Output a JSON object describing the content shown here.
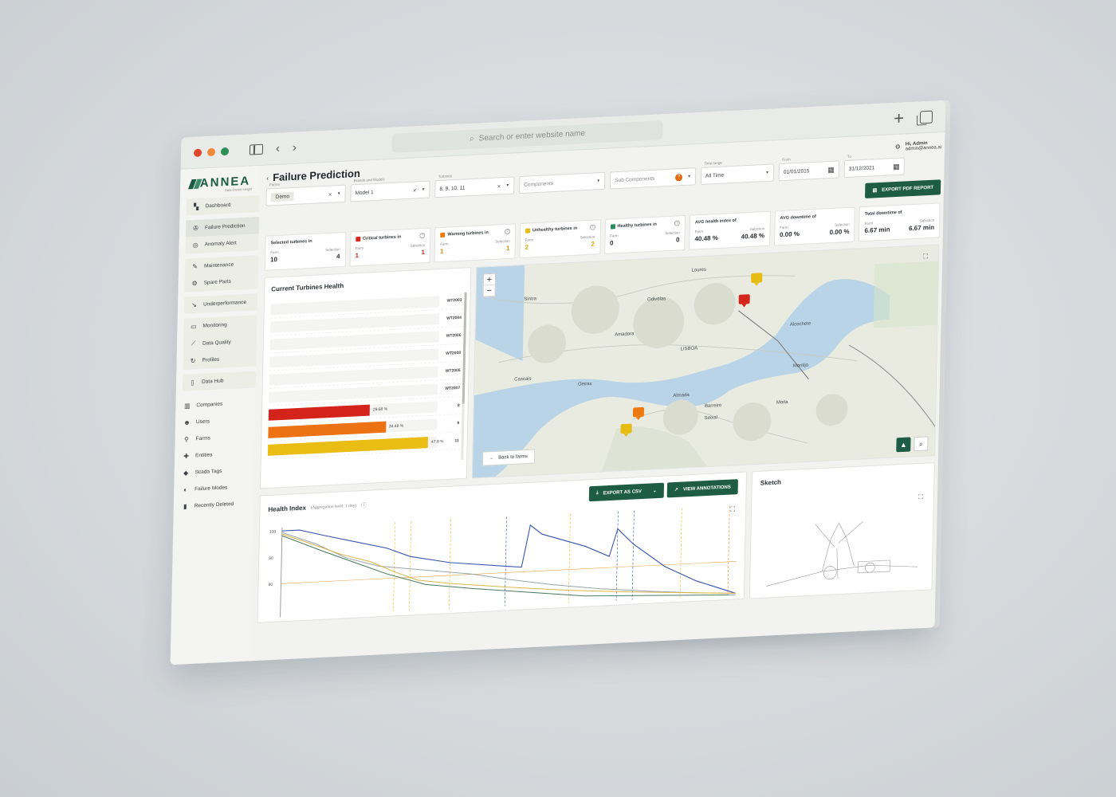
{
  "browser": {
    "search_placeholder": "Search or enter website name",
    "colors": {
      "close": "#e0452d",
      "minimize": "#f08a3a",
      "maximize": "#2f8f5b"
    },
    "icons": [
      "sidebar-toggle-icon",
      "back-arrow-icon",
      "forward-arrow-icon",
      "search-icon",
      "plus-icon",
      "tabs-icon"
    ]
  },
  "brand": {
    "name": "ANNEA",
    "tagline": "Data-Driven Insight"
  },
  "user": {
    "greeting": "Hi, Admin",
    "email": "admin@annea.ai"
  },
  "page": {
    "title": "Failure Prediction"
  },
  "sidebar": {
    "groups": [
      [
        {
          "label": "Dashboard",
          "icon": "dashboard-icon"
        }
      ],
      [
        {
          "label": "Failure Prediction",
          "icon": "wind-icon",
          "active": true
        },
        {
          "label": "Anomaly Alert",
          "icon": "alert-icon"
        }
      ],
      [
        {
          "label": "Maintenance",
          "icon": "wrench-icon"
        },
        {
          "label": "Spare Parts",
          "icon": "gear-icon"
        }
      ],
      [
        {
          "label": "Underperformance",
          "icon": "trend-down-icon"
        }
      ],
      [
        {
          "label": "Monitoring",
          "icon": "monitor-icon"
        },
        {
          "label": "Data Quality",
          "icon": "chart-icon"
        },
        {
          "label": "Profiles",
          "icon": "refresh-icon"
        }
      ],
      [
        {
          "label": "Data Hub",
          "icon": "file-icon"
        }
      ]
    ],
    "admin": [
      {
        "label": "Companies",
        "icon": "building-icon"
      },
      {
        "label": "Users",
        "icon": "users-icon"
      },
      {
        "label": "Farms",
        "icon": "pin-icon"
      },
      {
        "label": "Entities",
        "icon": "puzzle-icon"
      },
      {
        "label": "Scada Tags",
        "icon": "tag-icon"
      },
      {
        "label": "Failure Modes",
        "icon": "failure-icon"
      },
      {
        "label": "Recently Deleted",
        "icon": "trash-icon"
      }
    ]
  },
  "filters": {
    "farms": {
      "label": "Farms",
      "value": "Demo"
    },
    "brands": {
      "label": "Brands and Models",
      "value": "Model 1"
    },
    "turbines": {
      "label": "Turbines",
      "value": "8, 9, 10, 11"
    },
    "components": {
      "placeholder": "Components"
    },
    "sub_components": {
      "placeholder": "Sub Components",
      "badge": "?"
    },
    "time_range": {
      "label": "Time range",
      "value": "All Time"
    },
    "from": {
      "label": "From",
      "value": "01/01/2015"
    },
    "to": {
      "label": "To",
      "value": "31/12/2021"
    }
  },
  "actions": {
    "export_pdf": "EXPORT PDF REPORT",
    "export_csv": "EXPORT AS CSV",
    "view_annotations": "VIEW ANNOTATIONS",
    "back_to_farms": "Back to farms"
  },
  "kpis": [
    {
      "title": "Selected turbines in",
      "farm": "10",
      "selection": "4"
    },
    {
      "title": "Critical turbines in",
      "farm": "1",
      "selection": "1",
      "color": "#d3261c"
    },
    {
      "title": "Warning turbines in",
      "farm": "1",
      "selection": "1",
      "color": "#ec7a13"
    },
    {
      "title": "Unhealthy turbines in",
      "farm": "2",
      "selection": "2",
      "color": "#e6bc12"
    },
    {
      "title": "Healthy turbines in",
      "farm": "0",
      "selection": "0",
      "color": "#2a8a5c"
    },
    {
      "title": "AVG health index of",
      "farm": "40.48 %",
      "selection": "40.48 %"
    },
    {
      "title": "AVG downtime of",
      "farm": "0.00 %",
      "selection": "0.00 %"
    },
    {
      "title": "Total downtime of",
      "farm": "6.67 min",
      "selection": "6.67 min"
    }
  ],
  "kpi_labels": {
    "farm": "Farm",
    "selection": "Selection",
    "help": "?"
  },
  "health_panel": {
    "title": "Current Turbines Health",
    "rows": [
      {
        "label": "WT2003"
      },
      {
        "label": "WT2004"
      },
      {
        "label": "WT2006"
      },
      {
        "label": "WT2008"
      },
      {
        "label": "WT2005"
      },
      {
        "label": "WT2007"
      },
      {
        "label": "8",
        "value": 29.68,
        "value_text": "29.68 %",
        "color": "#d4231b"
      },
      {
        "label": "9",
        "value": 34.48,
        "value_text": "34.48 %",
        "color": "#ec7214"
      },
      {
        "label": "11",
        "value": 47.0,
        "value_text": "47.0 %",
        "color": "#e9bd13"
      }
    ]
  },
  "map": {
    "labels": [
      "Loures",
      "Sintra",
      "Odivelas",
      "Amadora",
      "LISBOA",
      "Cascais",
      "Oeiras",
      "Almada",
      "Barreiro",
      "Seixal",
      "Moita",
      "Montijo",
      "Alcochete"
    ],
    "zoom_in": "+",
    "zoom_out": "−"
  },
  "chart": {
    "title": "Health Index",
    "aggregation": "(Aggregation level: 1 day)",
    "y_ticks": [
      "100",
      "90",
      "80"
    ]
  },
  "sketch": {
    "title": "Sketch"
  }
}
